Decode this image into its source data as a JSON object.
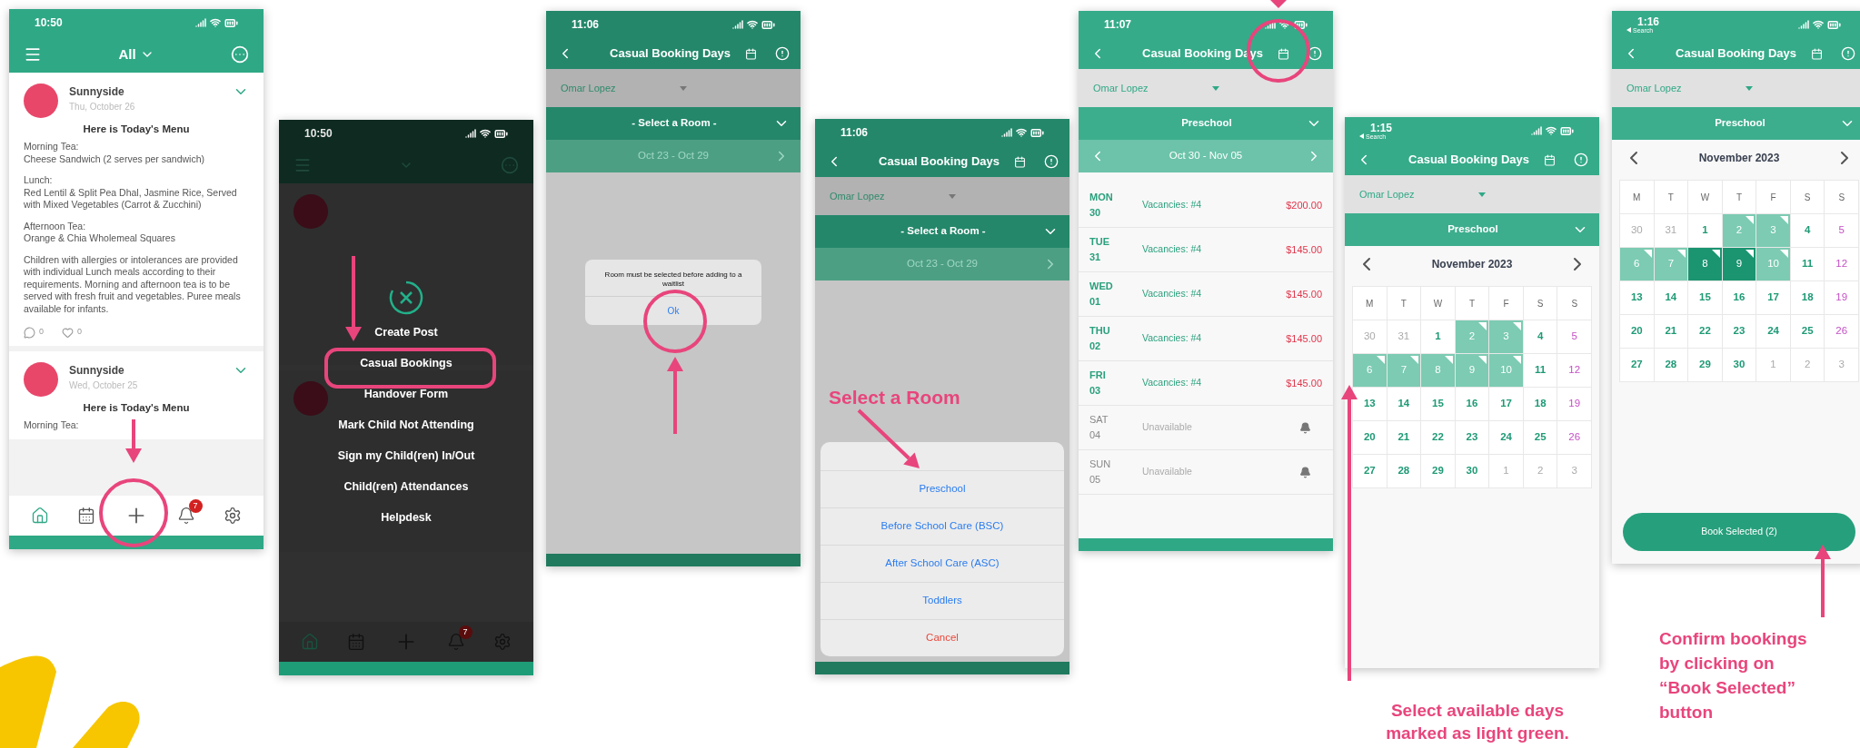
{
  "screens": [
    {
      "kind": "feed",
      "time": "10:50",
      "filter": "All",
      "posts": [
        {
          "author": "Sunnyside",
          "date": "Thu, October 26",
          "title": "Here is Today's Menu",
          "body": [
            "Morning Tea:\nCheese Sandwich (2 serves per sandwich)",
            "Lunch:\nRed Lentil & Split Pea Dhal, Jasmine Rice, Served with Mixed Vegetables (Carrot & Zucchini)",
            "Afternoon Tea:\nOrange & Chia Wholemeal Squares",
            "Children with allergies or intolerances are provided with individual Lunch meals according to their requirements. Morning and afternoon tea is to be served with fresh fruit and vegetables. Puree meals available for infants."
          ],
          "comments": "0",
          "likes": "0"
        },
        {
          "author": "Sunnyside",
          "date": "Wed, October 25",
          "title": "Here is Today's Menu",
          "body": [
            "Morning Tea:"
          ]
        }
      ],
      "nav": [
        {
          "selected": true
        },
        {
          "selected": false
        },
        {
          "selected": false
        },
        {
          "selected": false,
          "badge": "7"
        },
        {
          "selected": false
        }
      ]
    },
    {
      "kind": "feed_menu",
      "time": "10:50",
      "menu": [
        "Create Post",
        "Casual Bookings",
        "Handover Form",
        "Mark Child Not Attending",
        "Sign my Child(ren) In/Out",
        "Child(ren) Attendances",
        "Helpdesk"
      ],
      "nav": [
        {
          "selected": true
        },
        {
          "selected": false
        },
        {
          "selected": false
        },
        {
          "selected": false,
          "badge": "7"
        },
        {
          "selected": false
        }
      ]
    },
    {
      "kind": "booking_alert",
      "dimmed": true,
      "time": "11:06",
      "title": "Casual Booking Days",
      "child": "Omar Lopez",
      "room": "- Select a Room -",
      "week": "Oct 23 - Oct 29",
      "alert": {
        "message": "Room must be selected before adding to a waitlist",
        "button": "Ok"
      }
    },
    {
      "kind": "booking_sheet",
      "dimmed": true,
      "time": "11:06",
      "title": "Casual Booking Days",
      "child": "Omar Lopez",
      "room": "- Select a Room -",
      "week": "Oct 23 - Oct 29",
      "options": [
        "Preschool",
        "Before School Care (BSC)",
        "After School Care (ASC)",
        "Toddlers"
      ],
      "cancel": "Cancel"
    },
    {
      "kind": "booking_list",
      "dimmed": false,
      "time": "11:07",
      "title": "Casual Booking Days",
      "child": "Omar Lopez",
      "room": "Preschool",
      "week": "Oct 30 - Nov 05",
      "days": [
        {
          "day": "MON",
          "date": "30",
          "status": "Vacancies: #4",
          "price": "$200.00",
          "available": true
        },
        {
          "day": "TUE",
          "date": "31",
          "status": "Vacancies: #4",
          "price": "$145.00",
          "available": true
        },
        {
          "day": "WED",
          "date": "01",
          "status": "Vacancies: #4",
          "price": "$145.00",
          "available": true
        },
        {
          "day": "THU",
          "date": "02",
          "status": "Vacancies: #4",
          "price": "$145.00",
          "available": true
        },
        {
          "day": "FRI",
          "date": "03",
          "status": "Vacancies: #4",
          "price": "$145.00",
          "available": true
        },
        {
          "day": "SAT",
          "date": "04",
          "status": "Unavailable",
          "available": false
        },
        {
          "day": "SUN",
          "date": "05",
          "status": "Unavailable",
          "available": false
        }
      ]
    },
    {
      "kind": "calendar",
      "dimmed": false,
      "time": "1:15",
      "back_label": "Search",
      "title": "Casual Booking Days",
      "child": "Omar Lopez",
      "room": "Preschool",
      "month": "November 2023",
      "weekdays": [
        "M",
        "T",
        "W",
        "T",
        "F",
        "S",
        "S"
      ],
      "cells": [
        {
          "label": "30",
          "kind": "other"
        },
        {
          "label": "31",
          "kind": "other"
        },
        {
          "label": "1",
          "kind": "day"
        },
        {
          "label": "2",
          "kind": "available"
        },
        {
          "label": "3",
          "kind": "available"
        },
        {
          "label": "4",
          "kind": "day"
        },
        {
          "label": "5",
          "kind": "weekend"
        },
        {
          "label": "6",
          "kind": "available"
        },
        {
          "label": "7",
          "kind": "available"
        },
        {
          "label": "8",
          "kind": "available"
        },
        {
          "label": "9",
          "kind": "available"
        },
        {
          "label": "10",
          "kind": "available"
        },
        {
          "label": "11",
          "kind": "day"
        },
        {
          "label": "12",
          "kind": "weekend"
        },
        {
          "label": "13",
          "kind": "day"
        },
        {
          "label": "14",
          "kind": "day"
        },
        {
          "label": "15",
          "kind": "day"
        },
        {
          "label": "16",
          "kind": "day"
        },
        {
          "label": "17",
          "kind": "day"
        },
        {
          "label": "18",
          "kind": "day"
        },
        {
          "label": "19",
          "kind": "weekend"
        },
        {
          "label": "20",
          "kind": "day"
        },
        {
          "label": "21",
          "kind": "day"
        },
        {
          "label": "22",
          "kind": "day"
        },
        {
          "label": "23",
          "kind": "day"
        },
        {
          "label": "24",
          "kind": "day"
        },
        {
          "label": "25",
          "kind": "day"
        },
        {
          "label": "26",
          "kind": "weekend"
        },
        {
          "label": "27",
          "kind": "day"
        },
        {
          "label": "28",
          "kind": "day"
        },
        {
          "label": "29",
          "kind": "day"
        },
        {
          "label": "30",
          "kind": "day"
        },
        {
          "label": "1",
          "kind": "other"
        },
        {
          "label": "2",
          "kind": "other"
        },
        {
          "label": "3",
          "kind": "other"
        }
      ]
    },
    {
      "kind": "calendar",
      "dimmed": false,
      "time": "1:16",
      "back_label": "Search",
      "title": "Casual Booking Days",
      "child": "Omar Lopez",
      "room": "Preschool",
      "month": "November 2023",
      "weekdays": [
        "M",
        "T",
        "W",
        "T",
        "F",
        "S",
        "S"
      ],
      "cells": [
        {
          "label": "30",
          "kind": "other"
        },
        {
          "label": "31",
          "kind": "other"
        },
        {
          "label": "1",
          "kind": "day"
        },
        {
          "label": "2",
          "kind": "available"
        },
        {
          "label": "3",
          "kind": "available"
        },
        {
          "label": "4",
          "kind": "day"
        },
        {
          "label": "5",
          "kind": "weekend"
        },
        {
          "label": "6",
          "kind": "available"
        },
        {
          "label": "7",
          "kind": "available"
        },
        {
          "label": "8",
          "kind": "selected"
        },
        {
          "label": "9",
          "kind": "selected"
        },
        {
          "label": "10",
          "kind": "available"
        },
        {
          "label": "11",
          "kind": "day"
        },
        {
          "label": "12",
          "kind": "weekend"
        },
        {
          "label": "13",
          "kind": "day"
        },
        {
          "label": "14",
          "kind": "day"
        },
        {
          "label": "15",
          "kind": "day"
        },
        {
          "label": "16",
          "kind": "day"
        },
        {
          "label": "17",
          "kind": "day"
        },
        {
          "label": "18",
          "kind": "day"
        },
        {
          "label": "19",
          "kind": "weekend"
        },
        {
          "label": "20",
          "kind": "day"
        },
        {
          "label": "21",
          "kind": "day"
        },
        {
          "label": "22",
          "kind": "day"
        },
        {
          "label": "23",
          "kind": "day"
        },
        {
          "label": "24",
          "kind": "day"
        },
        {
          "label": "25",
          "kind": "day"
        },
        {
          "label": "26",
          "kind": "weekend"
        },
        {
          "label": "27",
          "kind": "day"
        },
        {
          "label": "28",
          "kind": "day"
        },
        {
          "label": "29",
          "kind": "day"
        },
        {
          "label": "30",
          "kind": "day"
        },
        {
          "label": "1",
          "kind": "other"
        },
        {
          "label": "2",
          "kind": "other"
        },
        {
          "label": "3",
          "kind": "other"
        }
      ],
      "button": "Book Selected (2)"
    }
  ],
  "annotations": [
    "Select a Room",
    "Select available days\nmarked as light green.",
    "Confirm bookings\nby clicking on\n“Book Selected”\nbutton"
  ]
}
